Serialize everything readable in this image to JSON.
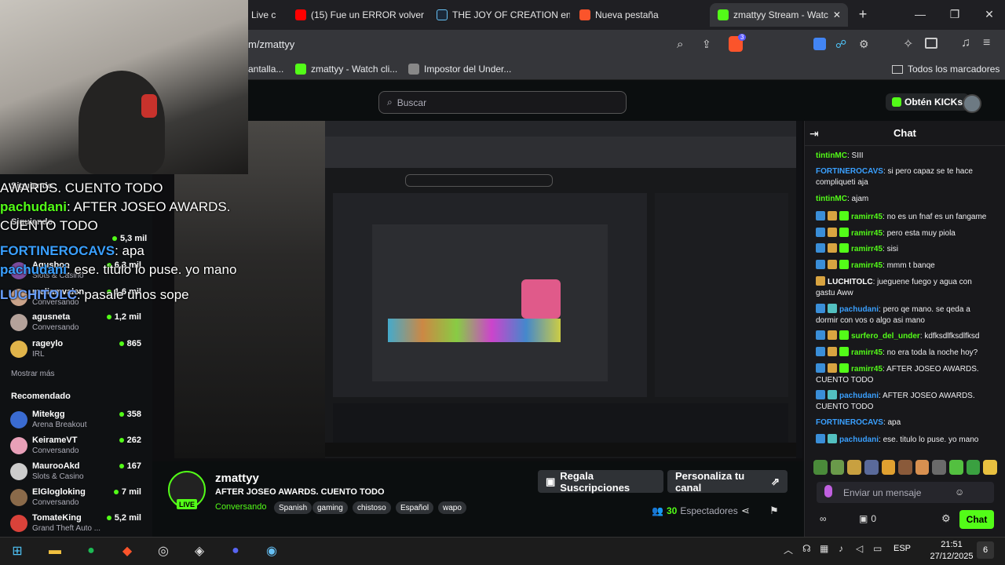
{
  "browser": {
    "tabs": [
      {
        "label": "Live c"
      },
      {
        "label": "(15) Fue un ERROR volver"
      },
      {
        "label": "THE JOY OF CREATION en"
      },
      {
        "label": "Nueva pestaña"
      },
      {
        "label": "zmattyy Stream - Watc"
      }
    ],
    "new_tab": "+",
    "url": "m/zmattyy",
    "bookmarks": [
      {
        "label": "antalla..."
      },
      {
        "label": "zmattyy - Watch cli..."
      },
      {
        "label": "Impostor del Under..."
      }
    ],
    "all_bookmarks": "Todos los marcadores",
    "brave_badge": "3"
  },
  "kick": {
    "search_placeholder": "Buscar",
    "obten_kicks": "Obtén KICKs"
  },
  "sidebar": {
    "following_label": "Siguiendo",
    "following_label2": "Siguiendo",
    "following": [
      {
        "name": "Agusboo",
        "sub": "Slots & Casino",
        "viewers": "6,3 mil"
      },
      {
        "name": "meliamvalen",
        "sub": "Conversando",
        "viewers": "1,6 mil"
      },
      {
        "name": "agusneta",
        "sub": "Conversando",
        "viewers": "1,2 mil"
      },
      {
        "name": "rageylo",
        "sub": "IRL",
        "viewers": "865"
      }
    ],
    "partial_viewers": "5,3 mil",
    "show_more": "Mostrar más",
    "recommended_label": "Recomendado",
    "recommended": [
      {
        "name": "Mitekgg",
        "sub": "Arena Breakout",
        "viewers": "358",
        "color": "#3a6bd1"
      },
      {
        "name": "KeirameVT",
        "sub": "Conversando",
        "viewers": "262",
        "color": "#e8a0b8"
      },
      {
        "name": "MaurooAkd",
        "sub": "Slots & Casino",
        "viewers": "167",
        "color": "#cccccc"
      },
      {
        "name": "ElGlogloking",
        "sub": "Conversando",
        "viewers": "7 mil",
        "color": "#8a6a4a"
      },
      {
        "name": "TomateKing",
        "sub": "Grand Theft Auto ...",
        "viewers": "5,2 mil",
        "color": "#d9423a"
      }
    ]
  },
  "overlay_chat": [
    {
      "user": "",
      "text": "AWARDS. CUENTO TODO"
    },
    {
      "user": "pachudani",
      "text": ": AFTER JOSEO AWARDS. CUENTO TODO"
    },
    {
      "user": "FORTINEROCAVS",
      "text": ": apa"
    },
    {
      "user": "pachudani",
      "text": ": ese. titulo lo puse. yo mano"
    },
    {
      "user": "LUCHITOLC",
      "text": ": pasale unos sope"
    }
  ],
  "stream": {
    "name": "zmattyy",
    "live": "LIVE",
    "title": "AFTER JOSEO AWARDS. CUENTO TODO",
    "category": "Conversando",
    "tags": [
      "Spanish",
      "gaming",
      "chistoso",
      "Español",
      "wapo"
    ],
    "gift_subs": "Regala Suscripciones",
    "customize": "Personaliza tu canal",
    "viewer_count": "30",
    "viewers_label": "Espectadores"
  },
  "chat": {
    "title": "Chat",
    "messages": [
      {
        "user": "tintinMC",
        "text": ": SIII",
        "color": "#53fc18",
        "badges": 0
      },
      {
        "user": "FORTINEROCAVS",
        "text": ": si pero capaz se te hace compliqueti aja",
        "color": "#3aa0ff",
        "badges": 0
      },
      {
        "user": "tintinMC",
        "text": ": ajam",
        "color": "#53fc18",
        "badges": 0
      },
      {
        "user": "ramirr45",
        "text": ": no es un fnaf es un fangame",
        "color": "#53fc18",
        "badges": 3
      },
      {
        "user": "ramirr45",
        "text": ": pero esta muy piola",
        "color": "#53fc18",
        "badges": 3
      },
      {
        "user": "ramirr45",
        "text": ": sisi",
        "color": "#53fc18",
        "badges": 3
      },
      {
        "user": "ramirr45",
        "text": ": mmm t banqe",
        "color": "#53fc18",
        "badges": 3
      },
      {
        "user": "LUCHITOLC",
        "text": ": jueguene fuego y agua con gastu Aww",
        "color": "#ffffff",
        "badges": 1
      },
      {
        "user": "pachudani",
        "text": ": pero qe mano. se qeda a dormir con vos o algo asi mano",
        "color": "#3aa0ff",
        "badges": 2
      },
      {
        "user": "surfero_del_under",
        "text": ": kdfksdlfksdlfksd",
        "color": "#53fc18",
        "badges": 3
      },
      {
        "user": "ramirr45",
        "text": ": no era toda la noche hoy?",
        "color": "#53fc18",
        "badges": 3
      },
      {
        "user": "ramirr45",
        "text": ": AFTER JOSEO AWARDS. CUENTO TODO",
        "color": "#53fc18",
        "badges": 3
      },
      {
        "user": "pachudani",
        "text": ": AFTER JOSEO AWARDS. CUENTO TODO",
        "color": "#3aa0ff",
        "badges": 2
      },
      {
        "user": "FORTINEROCAVS",
        "text": ": apa",
        "color": "#3aa0ff",
        "badges": 0
      },
      {
        "user": "pachudani",
        "text": ": ese. titulo lo puse. yo mano",
        "color": "#3aa0ff",
        "badges": 2
      }
    ],
    "input_placeholder": "Enviar un mensaje",
    "send": "Chat",
    "kicks_count": "0"
  },
  "taskbar": {
    "time": "21:51",
    "date": "27/12/2025",
    "lang": "ESP",
    "notifications": "6"
  }
}
